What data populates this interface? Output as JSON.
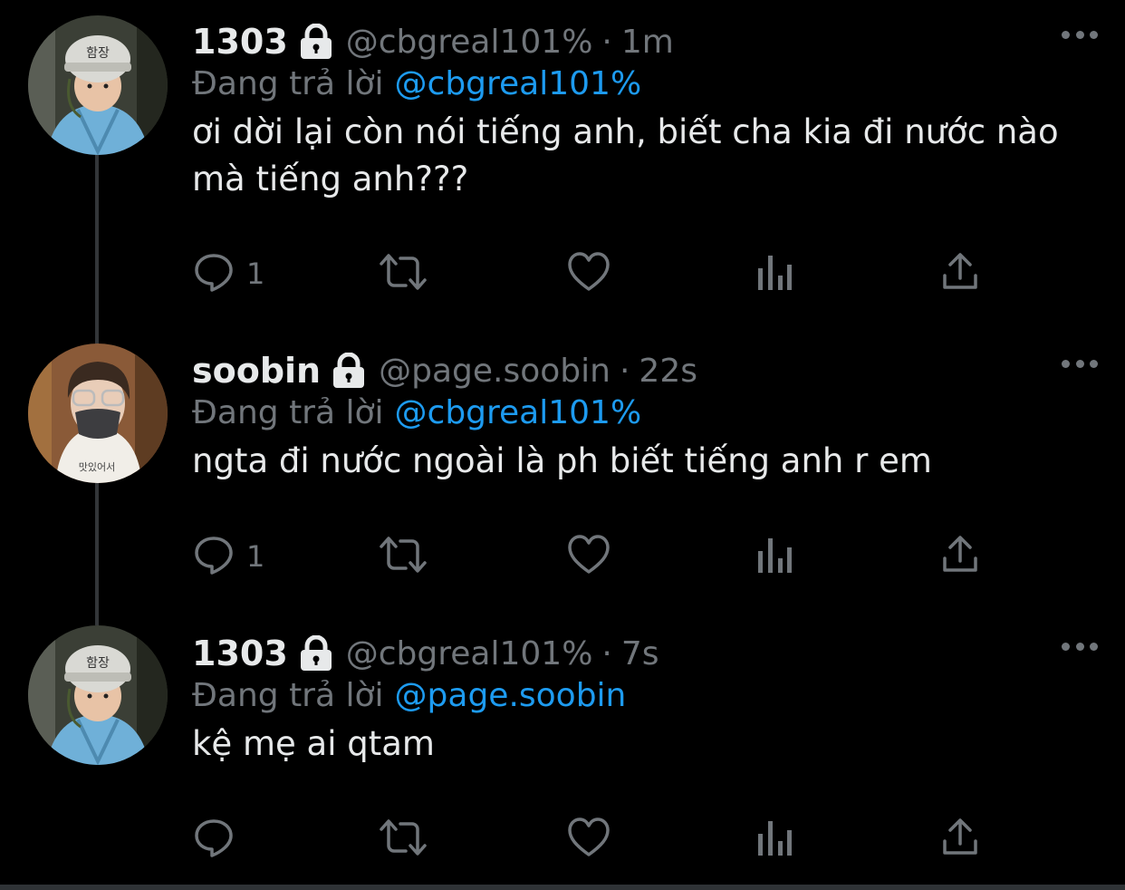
{
  "tweets": [
    {
      "name": "1303",
      "handle": "@cbgreal101%",
      "time": "1m",
      "reply_prefix": "Đang trả lời",
      "reply_to": "@cbgreal101%",
      "text": "ơi dời lại còn nói tiếng anh, biết cha kia đi nước nào mà tiếng anh???",
      "reply_count": "1",
      "avatar": "helmet-child-avatar"
    },
    {
      "name": "soobin",
      "handle": "@page.soobin",
      "time": "22s",
      "reply_prefix": "Đang trả lời",
      "reply_to": "@cbgreal101%",
      "text": "ngta đi nước ngoài là ph biết tiếng anh r em",
      "reply_count": "1",
      "avatar": "masked-person-avatar"
    },
    {
      "name": "1303",
      "handle": "@cbgreal101%",
      "time": "7s",
      "reply_prefix": "Đang trả lời",
      "reply_to": "@page.soobin",
      "text": "kệ mẹ ai qtam",
      "reply_count": "",
      "avatar": "helmet-child-avatar"
    }
  ],
  "separator": "·",
  "icons": [
    "lock-icon",
    "more-icon",
    "reply-icon",
    "retweet-icon",
    "like-icon",
    "views-icon",
    "share-icon"
  ],
  "colors": {
    "background": "#000000",
    "text": "#e7e9ea",
    "secondary": "#71767b",
    "link": "#1d9bf0",
    "thread_line": "#333639"
  }
}
